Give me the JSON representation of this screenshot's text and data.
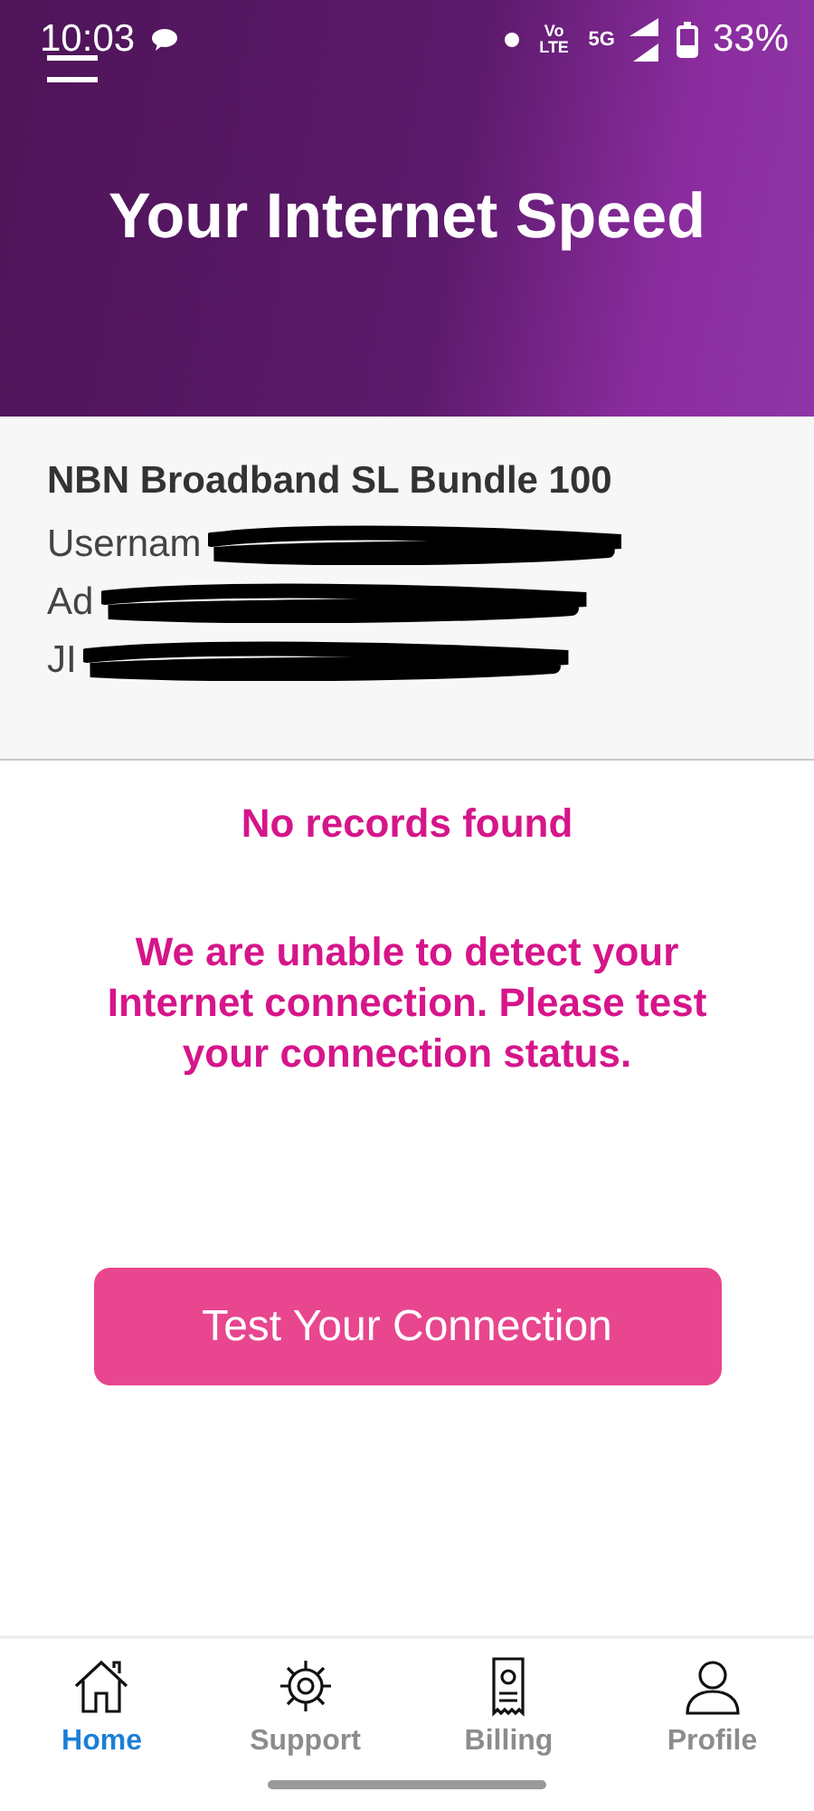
{
  "status_bar": {
    "time": "10:03",
    "network": "5G",
    "volte": "Vo LTE",
    "battery": "33%"
  },
  "header": {
    "title": "Your Internet Speed"
  },
  "account": {
    "plan": "NBN Broadband SL Bundle 100",
    "lines": [
      "Usernam",
      "Ad",
      "JI"
    ]
  },
  "message": {
    "title": "No records found",
    "body": "We are unable to detect your Internet connection. Please test your connection status."
  },
  "action_button": "Test Your Connection",
  "bottom_nav": [
    {
      "label": "Home",
      "kind": "home",
      "selected": true
    },
    {
      "label": "Support",
      "kind": "support",
      "selected": false
    },
    {
      "label": "Billing",
      "kind": "billing",
      "selected": false
    },
    {
      "label": "Profile",
      "kind": "profile",
      "selected": false
    }
  ]
}
